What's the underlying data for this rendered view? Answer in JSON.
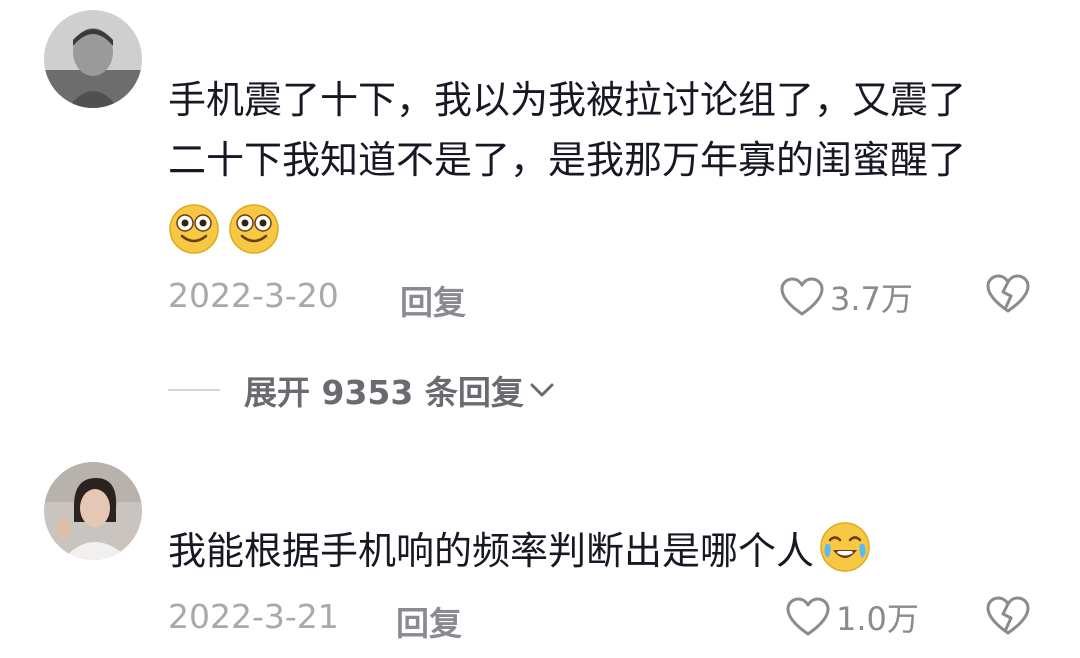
{
  "comments": [
    {
      "text_lines": [
        "手机震了十下，我以为我被拉讨论组了，又震了",
        "二十下我知道不是了，是我那万年寡的闺蜜醒了"
      ],
      "emojis": [
        "grin-emoji",
        "grin-emoji"
      ],
      "date": "2022-3-20",
      "reply_label": "回复",
      "likes": "3.7万",
      "expand_label": "展开 9353 条回复"
    },
    {
      "text_lines": [
        "我能根据手机响的频率判断出是哪个人"
      ],
      "emojis": [
        "crying-laughing-emoji"
      ],
      "date": "2022-3-21",
      "reply_label": "回复",
      "likes": "1.0万"
    }
  ],
  "colors": {
    "text": "#161823",
    "meta": "#a8a8ad",
    "icon": "#8a8a90"
  }
}
